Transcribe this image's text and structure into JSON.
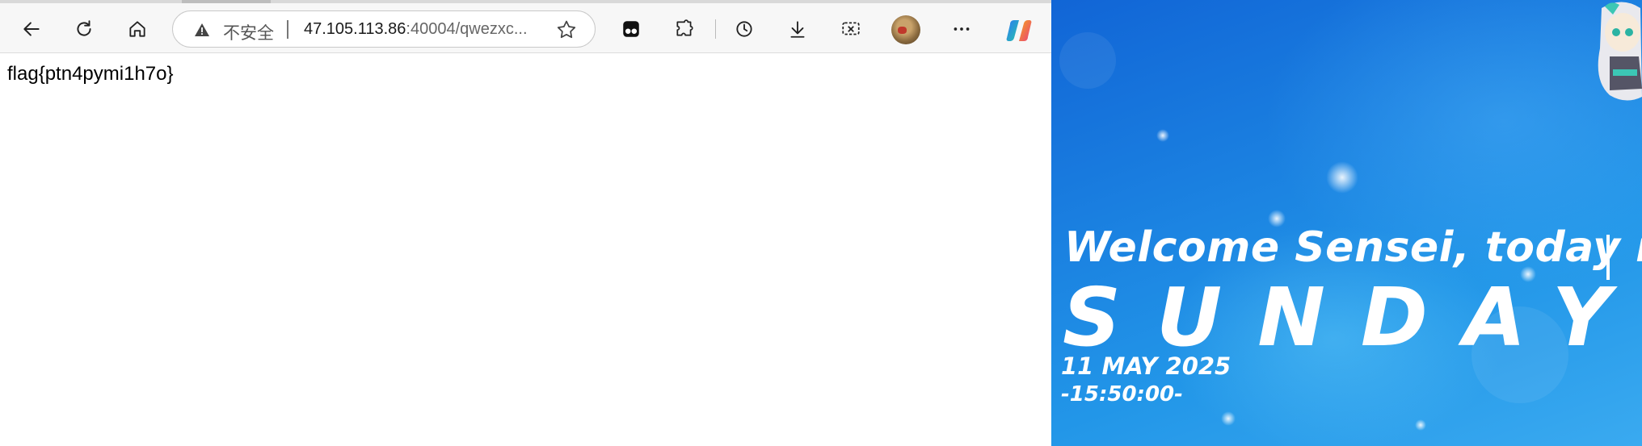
{
  "browser": {
    "toolbar": {
      "back": "back-arrow-icon",
      "refresh": "refresh-icon",
      "home": "home-icon"
    },
    "address_bar": {
      "security_label": "不安全",
      "url_host": "47.105.113.86",
      "url_rest": ":40004/qwezxc..."
    },
    "page": {
      "text": "flag{ptn4pymi1h7o}"
    }
  },
  "wallpaper": {
    "welcome": "Welcome Sensei, today is:",
    "day": "SUNDAY",
    "date": "11 MAY 2025",
    "time": "-15:50:00-"
  },
  "colors": {
    "wallpaper_blue": "#1a7fe0",
    "toolbar_bg": "#f7f7f7"
  }
}
